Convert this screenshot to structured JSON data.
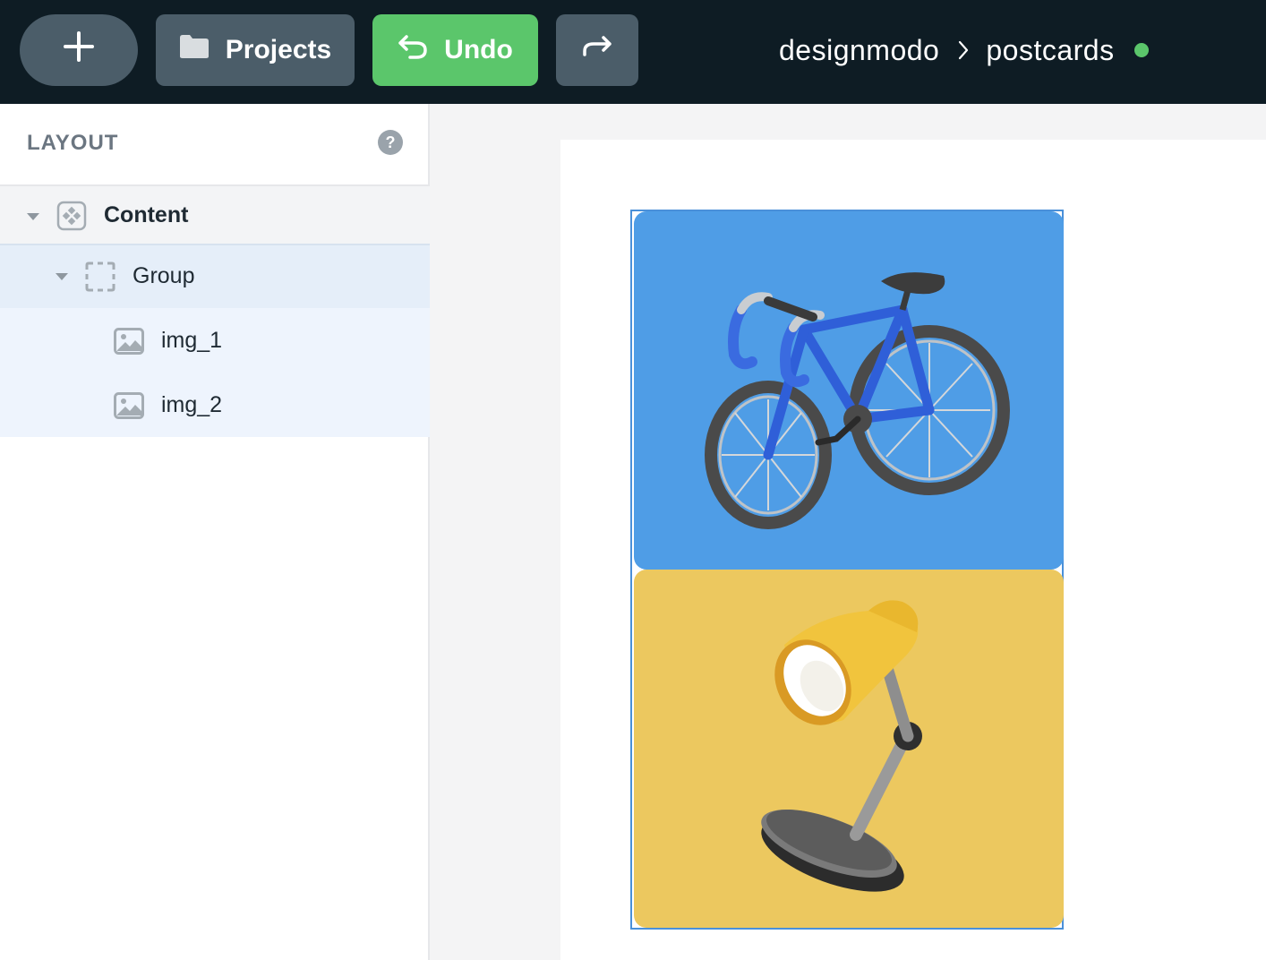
{
  "toolbar": {
    "add_icon": "plus-icon",
    "projects_label": "Projects",
    "projects_icon": "folder-icon",
    "undo_label": "Undo",
    "undo_icon": "undo-arrow-icon",
    "redo_icon": "redo-arrow-icon"
  },
  "breadcrumb": {
    "workspace": "designmodo",
    "separator_icon": "chevron-right-icon",
    "project": "postcards",
    "status_color": "#5bc66b"
  },
  "sidebar": {
    "title": "LAYOUT",
    "help": "?",
    "tree": [
      {
        "label": "Content",
        "icon": "component-icon",
        "expanded": true
      },
      {
        "label": "Group",
        "icon": "group-frame-icon",
        "expanded": true,
        "selected": true
      },
      {
        "label": "img_1",
        "icon": "image-icon"
      },
      {
        "label": "img_2",
        "icon": "image-icon"
      }
    ]
  },
  "canvas": {
    "cards": [
      {
        "name": "img_1",
        "subject": "bicycle",
        "background": "#4f9de6"
      },
      {
        "name": "img_2",
        "subject": "desk lamp",
        "background": "#ecc85f"
      }
    ]
  },
  "colors": {
    "topbar": "#0e1c24",
    "button_dark": "#4b5d69",
    "button_green": "#5bc66b",
    "selection": "#4a90d9"
  }
}
